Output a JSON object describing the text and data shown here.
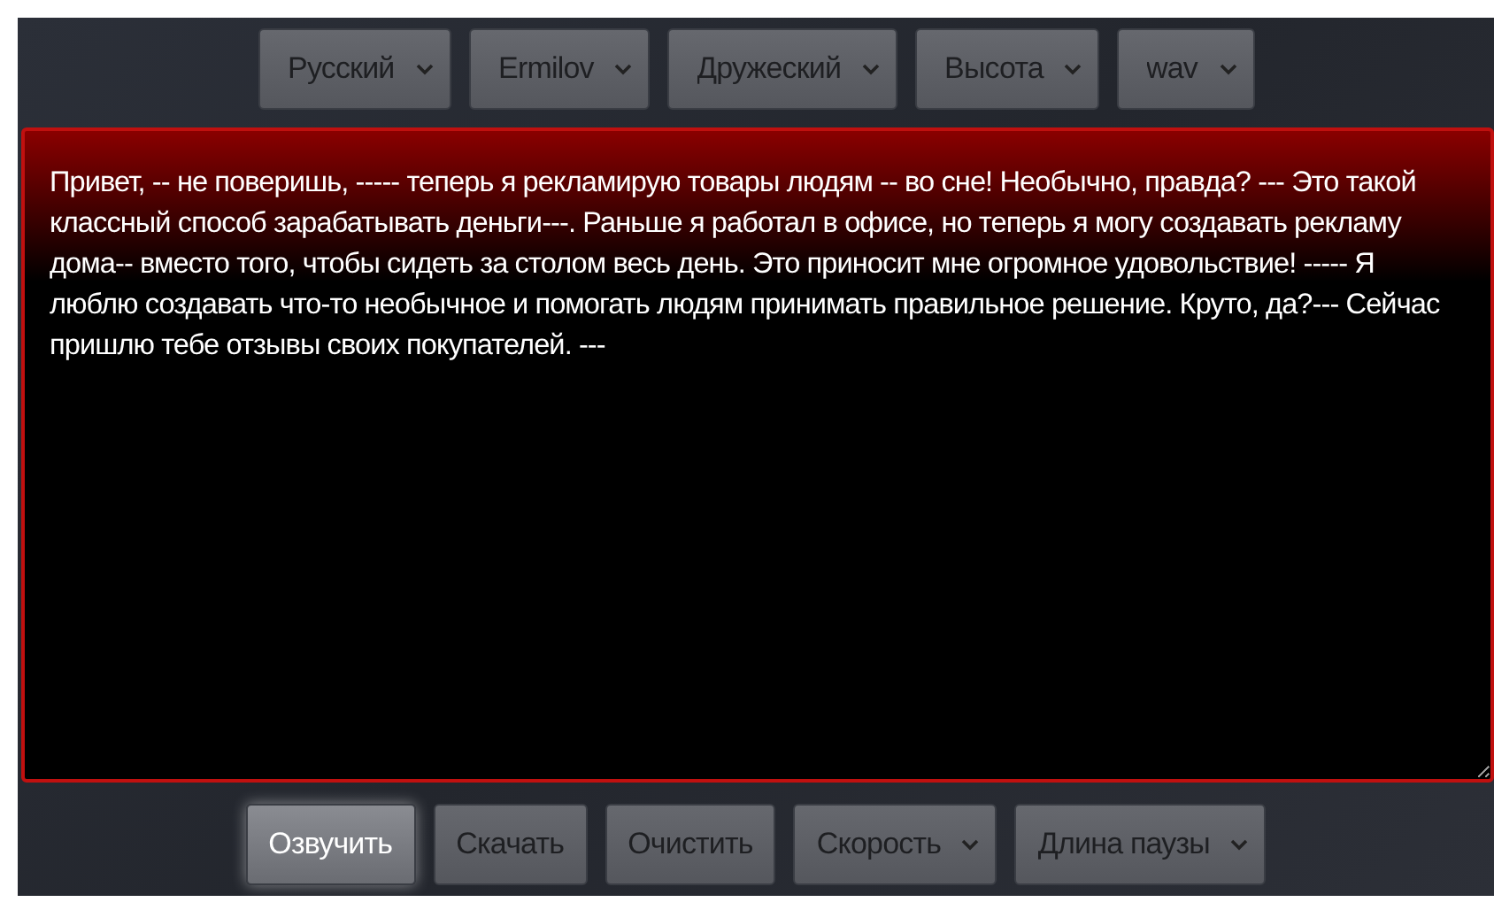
{
  "top_selects": [
    {
      "value": "Русский"
    },
    {
      "value": "Ermilov"
    },
    {
      "value": "Дружеский"
    },
    {
      "value": "Высота"
    },
    {
      "value": "wav"
    }
  ],
  "text_area": {
    "value": "Привет, -- не поверишь, ----- теперь я рекламирую товары людям -- во сне! Необычно, правда? --- Это такой классный способ зарабатывать деньги---. Раньше я работал в офисе, но теперь я могу создавать рекламу дома-- вместо того, чтобы сидеть за столом весь день. Это приносит мне огромное удовольствие! ----- Я люблю создавать что-то необычное и помогать людям принимать правильное решение. Круто, да?--- Сейчас пришлю тебе отзывы своих покупателей. ---"
  },
  "bottom_controls": [
    {
      "kind": "button",
      "label": "Озвучить",
      "highlighted": true
    },
    {
      "kind": "button",
      "label": "Скачать",
      "highlighted": false
    },
    {
      "kind": "button",
      "label": "Очистить",
      "highlighted": false
    },
    {
      "kind": "select",
      "label": "Скорость",
      "highlighted": false
    },
    {
      "kind": "select",
      "label": "Длина паузы",
      "highlighted": false
    }
  ]
}
